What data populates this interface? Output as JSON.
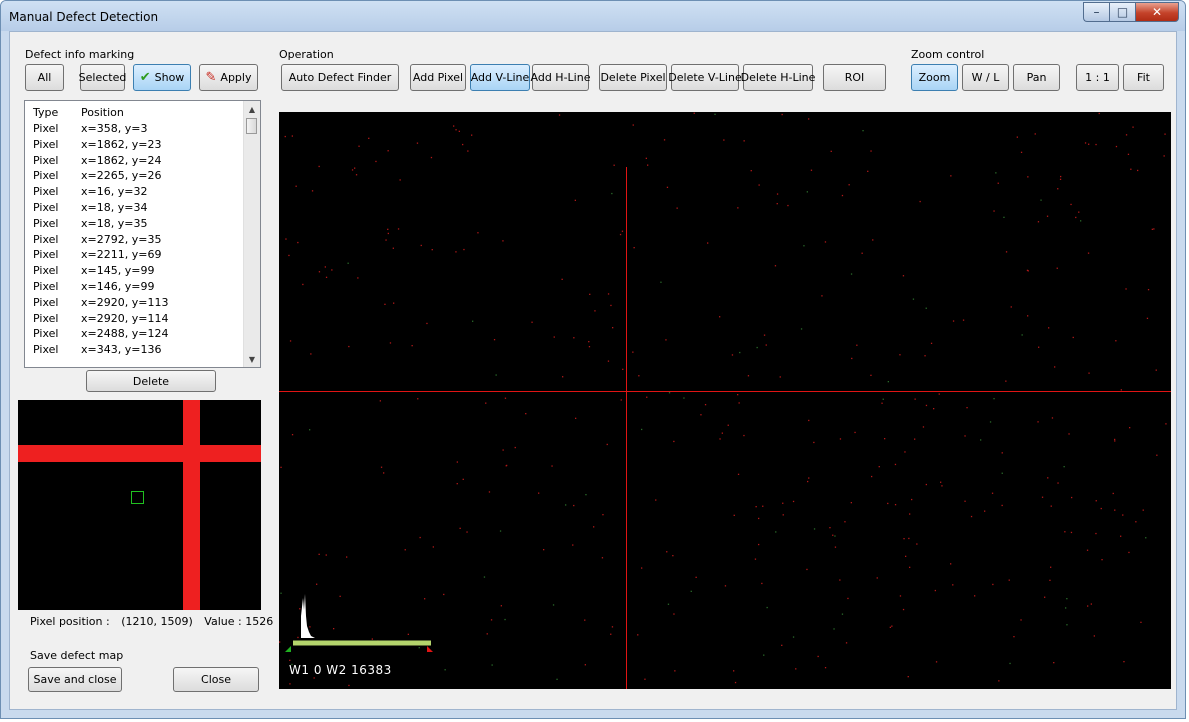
{
  "window": {
    "title": "Manual Defect Detection",
    "minimize": "–",
    "maximize": "□",
    "close": "✕"
  },
  "defect_marking": {
    "group_label": "Defect info marking",
    "all_label": "All",
    "selected_label": "Selected",
    "show_label": "Show",
    "apply_label": "Apply",
    "show_icon": "checkmark-icon",
    "apply_icon": "pencil-eraser-icon"
  },
  "defect_list": {
    "header_type": "Type",
    "header_position": "Position",
    "rows": [
      {
        "type": "Pixel",
        "position": "x=358, y=3"
      },
      {
        "type": "Pixel",
        "position": "x=1862, y=23"
      },
      {
        "type": "Pixel",
        "position": "x=1862, y=24"
      },
      {
        "type": "Pixel",
        "position": "x=2265, y=26"
      },
      {
        "type": "Pixel",
        "position": "x=16, y=32"
      },
      {
        "type": "Pixel",
        "position": "x=18, y=34"
      },
      {
        "type": "Pixel",
        "position": "x=18, y=35"
      },
      {
        "type": "Pixel",
        "position": "x=2792, y=35"
      },
      {
        "type": "Pixel",
        "position": "x=2211, y=69"
      },
      {
        "type": "Pixel",
        "position": "x=145, y=99"
      },
      {
        "type": "Pixel",
        "position": "x=146, y=99"
      },
      {
        "type": "Pixel",
        "position": "x=2920, y=113"
      },
      {
        "type": "Pixel",
        "position": "x=2920, y=114"
      },
      {
        "type": "Pixel",
        "position": "x=2488, y=124"
      },
      {
        "type": "Pixel",
        "position": "x=343, y=136"
      }
    ],
    "delete_label": "Delete"
  },
  "pixel_info": {
    "position_label": "Pixel position :",
    "position_value": "(1210, 1509)",
    "value_label": "Value :",
    "value": "1526"
  },
  "save_group": {
    "group_label": "Save defect map",
    "save_close_label": "Save and close",
    "close_label": "Close"
  },
  "operation": {
    "group_label": "Operation",
    "auto_defect_finder": "Auto Defect Finder",
    "add_pixel": "Add Pixel",
    "add_vline": "Add V-Line",
    "add_hline": "Add H-Line",
    "delete_pixel": "Delete Pixel",
    "delete_vline": "Delete V-Line",
    "delete_hline": "Delete H-Line",
    "roi": "ROI"
  },
  "zoom_control": {
    "group_label": "Zoom control",
    "zoom": "Zoom",
    "wl": "W / L",
    "pan": "Pan",
    "one_to_one": "1 : 1",
    "fit": "Fit"
  },
  "viewer": {
    "window_text": "W1 0  W2 16383"
  },
  "colors": {
    "defect_red": "#e01414",
    "preview_red": "#ee2020",
    "roi_green": "#20c020",
    "window_bar": "#b4d46c"
  }
}
